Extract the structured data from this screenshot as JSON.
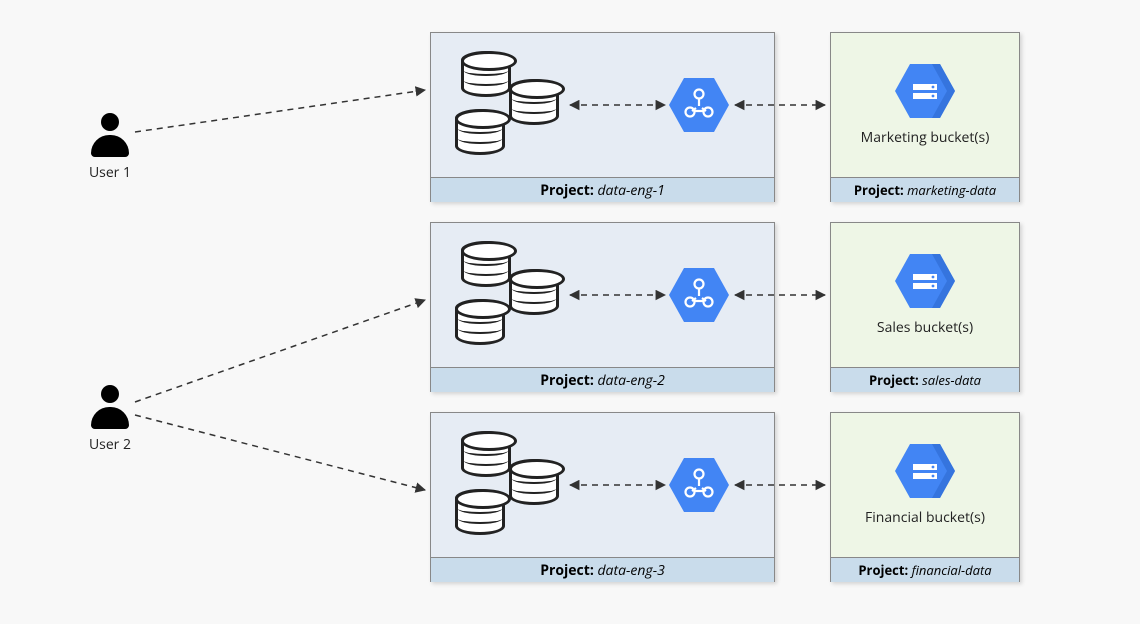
{
  "users": [
    {
      "label": "User 1"
    },
    {
      "label": "User 2"
    }
  ],
  "projects": [
    {
      "label_prefix": "Project:",
      "name": "data-eng-1"
    },
    {
      "label_prefix": "Project:",
      "name": "data-eng-2"
    },
    {
      "label_prefix": "Project:",
      "name": "data-eng-3"
    }
  ],
  "buckets": [
    {
      "title": "Marketing bucket(s)",
      "label_prefix": "Project:",
      "name": "marketing-data"
    },
    {
      "title": "Sales bucket(s)",
      "label_prefix": "Project:",
      "name": "sales-data"
    },
    {
      "title": "Financial bucket(s)",
      "label_prefix": "Project:",
      "name": "financial-data"
    }
  ],
  "colors": {
    "gcp_blue": "#4285f4",
    "project_bg": "#e6ecf4",
    "bucket_bg": "#eef6e6",
    "footer_bg": "#c9dceb"
  }
}
